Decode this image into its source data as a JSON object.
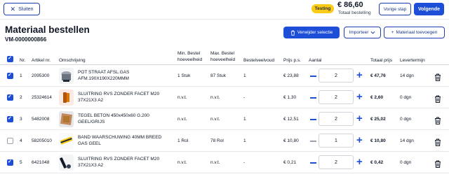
{
  "header": {
    "close_label": "Sluiten",
    "badge": "Testing",
    "total_amount": "86,60",
    "total_label": "Totaal bestelling",
    "prev_label": "Vorige stap",
    "next_label": "Volgende"
  },
  "page": {
    "title": "Materiaal bestellen",
    "order_number": "VM-0000000866",
    "remove_label": "Verwijder selectie",
    "import_label": "Importeer",
    "add_label": "Materiaal toevoegen"
  },
  "columns": {
    "nr": "Nr.",
    "article": "Artikel nr.",
    "description": "Omschrijving",
    "min_qty_1": "Min. Bestel",
    "min_qty_2": "hoeveelheid",
    "max_qty_1": "Max. Bestel",
    "max_qty_2": "hoeveelheid",
    "multiple": "Bestelveelvoud",
    "price": "Prijs p.s.",
    "amount": "Aantal",
    "total": "Totaal prijs",
    "delivery": "Levertermijn"
  },
  "rows": [
    {
      "checked": true,
      "nr": "1",
      "article": "2095300",
      "desc1": "POT STRAAT AFSL.GAS",
      "desc2": "AFM.190X190X220MMM",
      "min": "1 Stuk",
      "max": "87 Stuk",
      "multiple": "1",
      "price": "€ 23,88",
      "qty": "2",
      "total": "€ 47,76",
      "delivery": "14 dgn",
      "image": "pot-image"
    },
    {
      "checked": true,
      "nr": "2",
      "article": "25324614",
      "desc1": "SLUITRING RVS ZONDER FACET M20",
      "desc2": "37X21X3 A2",
      "min": "n.v.t.",
      "max": "n.v.t.",
      "multiple": "-",
      "price": "€ 1,30",
      "qty": "2",
      "total": "€ 2,60",
      "delivery": "0 dgn",
      "image": "washer-image"
    },
    {
      "checked": true,
      "nr": "3",
      "article": "5482008",
      "desc1": "TEGEL BETON 450x450x60 G.200",
      "desc2": "GEEL/GRIJS",
      "min": "n.v.t.",
      "max": "n.v.t.",
      "multiple": "1",
      "price": "€ 12,51",
      "qty": "2",
      "total": "€ 25,02",
      "delivery": "0 dgn",
      "image": "tile-image"
    },
    {
      "checked": false,
      "nr": "4",
      "article": "58205010",
      "desc1": "BAND WAARSCHUWING 40MM BREED",
      "desc2": "GAS GEEL",
      "min": "1 Rol",
      "max": "78 Rol",
      "multiple": "1",
      "price": "€ 10,80",
      "qty": "1",
      "total": "€ 10,80",
      "delivery": "14 dgn",
      "image": "tape-image"
    },
    {
      "checked": true,
      "nr": "5",
      "article": "6421048",
      "desc1": "SLUITRING RVS ZONDER FACET M20",
      "desc2": "37X21X3 A2",
      "min": "n.v.t.",
      "max": "n.v.t.",
      "multiple": "-",
      "price": "€ 0,21",
      "qty": "2",
      "total": "€ 0,42",
      "delivery": "0 dgn",
      "image": "washer-image"
    }
  ],
  "colors": {
    "primary": "#1d4ed8",
    "badge": "#facc15"
  }
}
